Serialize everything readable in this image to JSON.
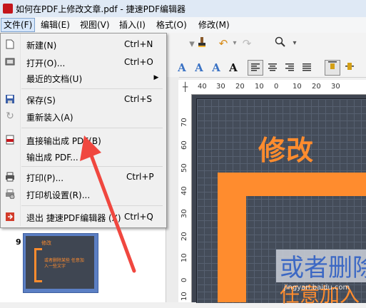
{
  "window": {
    "title": "如何在PDF上修改文章.pdf - 捷速PDF编辑器"
  },
  "menubar": [
    {
      "label": "文件(F)"
    },
    {
      "label": "编辑(E)"
    },
    {
      "label": "视图(V)"
    },
    {
      "label": "插入(I)"
    },
    {
      "label": "格式(O)"
    },
    {
      "label": "修改(M)"
    }
  ],
  "file_menu": {
    "items": [
      {
        "label": "新建(N)",
        "shortcut": "Ctrl+N",
        "icon": "new-doc-icon"
      },
      {
        "label": "打开(O)...",
        "shortcut": "Ctrl+O",
        "icon": "open-folder-icon"
      },
      {
        "label": "最近的文档(U)",
        "shortcut": "",
        "icon": "submenu-arrow-icon"
      },
      {
        "label": "保存(S)",
        "shortcut": "Ctrl+S",
        "icon": "save-icon"
      },
      {
        "label": "重新装入(A)",
        "shortcut": "",
        "icon": "reload-icon"
      },
      {
        "label": "直接输出成 PDF(B)",
        "shortcut": "",
        "icon": "pdf-icon"
      },
      {
        "label": "输出成 PDF...",
        "shortcut": "",
        "icon": ""
      },
      {
        "label": "打印(P)...",
        "shortcut": "Ctrl+P",
        "icon": "printer-icon"
      },
      {
        "label": "打印机设置(R)...",
        "shortcut": "",
        "icon": "printer-settings-icon"
      },
      {
        "label": "退出 捷速PDF编辑器 (X)",
        "shortcut": "Ctrl+Q",
        "icon": "exit-icon"
      }
    ]
  },
  "rulers": {
    "h_ticks": [
      "40",
      "30",
      "20",
      "10",
      "0",
      "10",
      "20",
      "30"
    ],
    "v_ticks": [
      "70",
      "60",
      "50",
      "40",
      "30",
      "20",
      "10",
      "0",
      "10"
    ]
  },
  "thumbnail": {
    "page_number": "9",
    "title": "修改",
    "text": "或者删除某些 任意加入一些文字"
  },
  "document": {
    "heading": "修改",
    "line1": "或者删除",
    "line2": "任意加入",
    "watermark": "jingyan.baidu.com"
  },
  "colors": {
    "accent": "#ff8c2e",
    "canvas": "#3e4450",
    "text_blue": "#3c68c4",
    "arrow": "#f0473f"
  }
}
